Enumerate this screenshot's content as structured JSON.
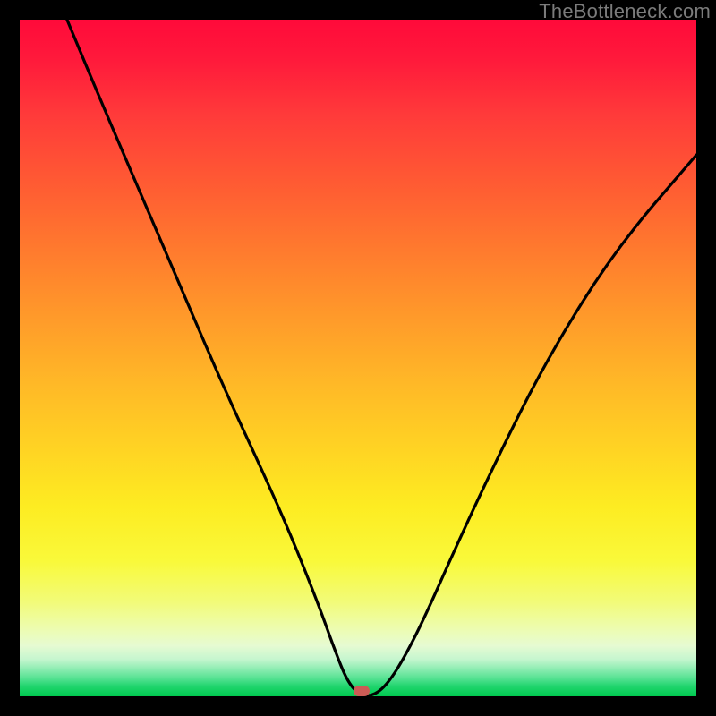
{
  "watermark": "TheBottleneck.com",
  "marker": {
    "x_pct": 50.5,
    "y_pct": 99.2,
    "color": "#cc5b55"
  },
  "chart_data": {
    "type": "line",
    "title": "",
    "xlabel": "",
    "ylabel": "",
    "xlim": [
      0,
      100
    ],
    "ylim": [
      0,
      100
    ],
    "grid": false,
    "legend": false,
    "series": [
      {
        "name": "bottleneck-curve",
        "x": [
          7,
          12,
          18,
          24,
          30,
          36,
          40,
          44,
          46.5,
          48.5,
          50.5,
          52.5,
          54.5,
          57,
          60,
          64,
          70,
          78,
          88,
          100
        ],
        "y": [
          100,
          88,
          74,
          60,
          46,
          33,
          24,
          14,
          7,
          2,
          0,
          0.2,
          2,
          6,
          12,
          21,
          34,
          50,
          66,
          80
        ]
      }
    ],
    "annotations": [
      {
        "type": "marker",
        "x": 50.5,
        "y": 0.8,
        "label": "optimal-point"
      }
    ],
    "background_gradient": {
      "stops": [
        {
          "pct": 0,
          "color": "#ff0a3a"
        },
        {
          "pct": 50,
          "color": "#ffb927"
        },
        {
          "pct": 80,
          "color": "#f9f93a"
        },
        {
          "pct": 100,
          "color": "#00c94f"
        }
      ]
    }
  }
}
